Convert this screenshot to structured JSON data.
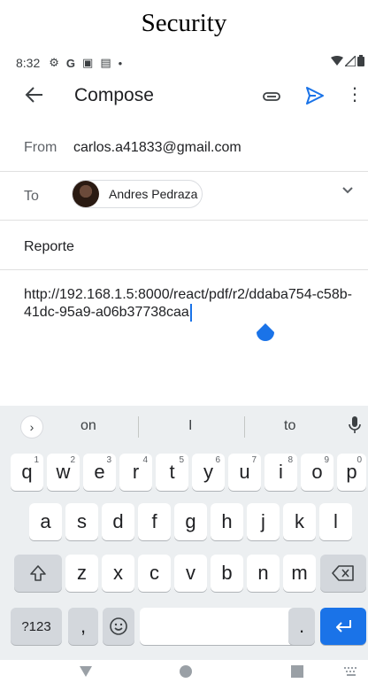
{
  "caption": "Security",
  "status_bar": {
    "time": "8:32",
    "icons": [
      "gear-icon",
      "google-icon",
      "photo-icon",
      "clipboard-icon",
      "dot-icon"
    ],
    "right_icons": [
      "wifi-icon",
      "signal-icon",
      "battery-icon"
    ]
  },
  "app_bar": {
    "title": "Compose",
    "icons": [
      "back-arrow-icon",
      "attachment-icon",
      "send-icon",
      "more-vert-icon"
    ]
  },
  "from": {
    "label": "From",
    "value": "carlos.a41833@gmail.com"
  },
  "to": {
    "label": "To",
    "recipient": "Andres Pedraza"
  },
  "subject": "Reporte",
  "body": "http://192.168.1.5:8000/react/pdf/r2/ddaba754-c58b-41dc-95a9-a06b37738caa",
  "keyboard": {
    "suggestions": [
      "on",
      "I",
      "to"
    ],
    "row1": [
      {
        "k": "q",
        "h": "1"
      },
      {
        "k": "w",
        "h": "2"
      },
      {
        "k": "e",
        "h": "3"
      },
      {
        "k": "r",
        "h": "4"
      },
      {
        "k": "t",
        "h": "5"
      },
      {
        "k": "y",
        "h": "6"
      },
      {
        "k": "u",
        "h": "7"
      },
      {
        "k": "i",
        "h": "8"
      },
      {
        "k": "o",
        "h": "9"
      },
      {
        "k": "p",
        "h": "0"
      }
    ],
    "row2": [
      "a",
      "s",
      "d",
      "f",
      "g",
      "h",
      "j",
      "k",
      "l"
    ],
    "row3": [
      "z",
      "x",
      "c",
      "v",
      "b",
      "n",
      "m"
    ],
    "row4": {
      "symbols": "?123",
      "comma": ",",
      "period": "."
    }
  },
  "colors": {
    "accent": "#1a73e8",
    "keyboard_bg": "#eceff1"
  }
}
